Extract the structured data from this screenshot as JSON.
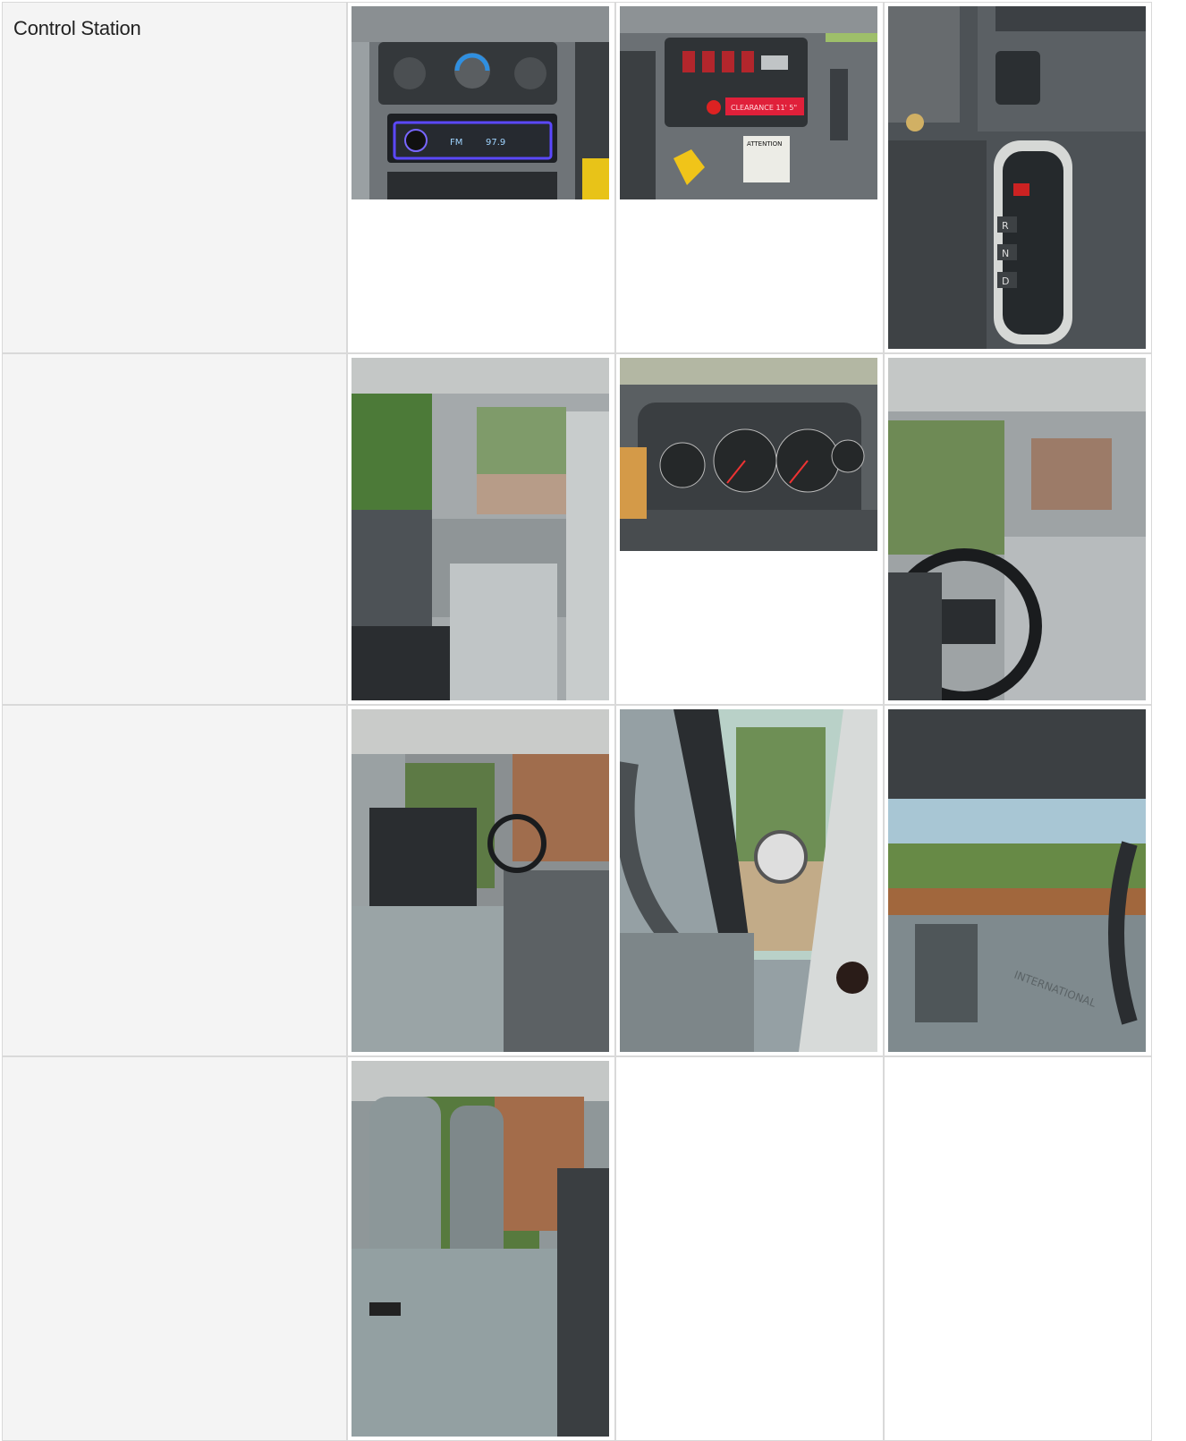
{
  "section": {
    "title": "Control Station"
  },
  "photos": [
    {
      "icon": "dashboard-radio-photo",
      "overlay_text": [
        "FM",
        "97.9"
      ]
    },
    {
      "icon": "dashboard-switches-photo",
      "overlay_text": [
        "CLEARANCE 11' 5\"",
        "ATTENTION"
      ]
    },
    {
      "icon": "shifter-photo",
      "overlay_text": [
        "R",
        "N",
        "D"
      ]
    },
    {
      "icon": "cab-interior-photo",
      "overlay_text": []
    },
    {
      "icon": "gauge-cluster-photo",
      "overlay_text": []
    },
    {
      "icon": "steering-wheel-photo",
      "overlay_text": []
    },
    {
      "icon": "bench-seat-photo",
      "overlay_text": []
    },
    {
      "icon": "mirror-photo",
      "overlay_text": []
    },
    {
      "icon": "dashboard-side-photo",
      "overlay_text": [
        "INTERNATIONAL"
      ]
    },
    {
      "icon": "seats-photo",
      "overlay_text": []
    }
  ]
}
